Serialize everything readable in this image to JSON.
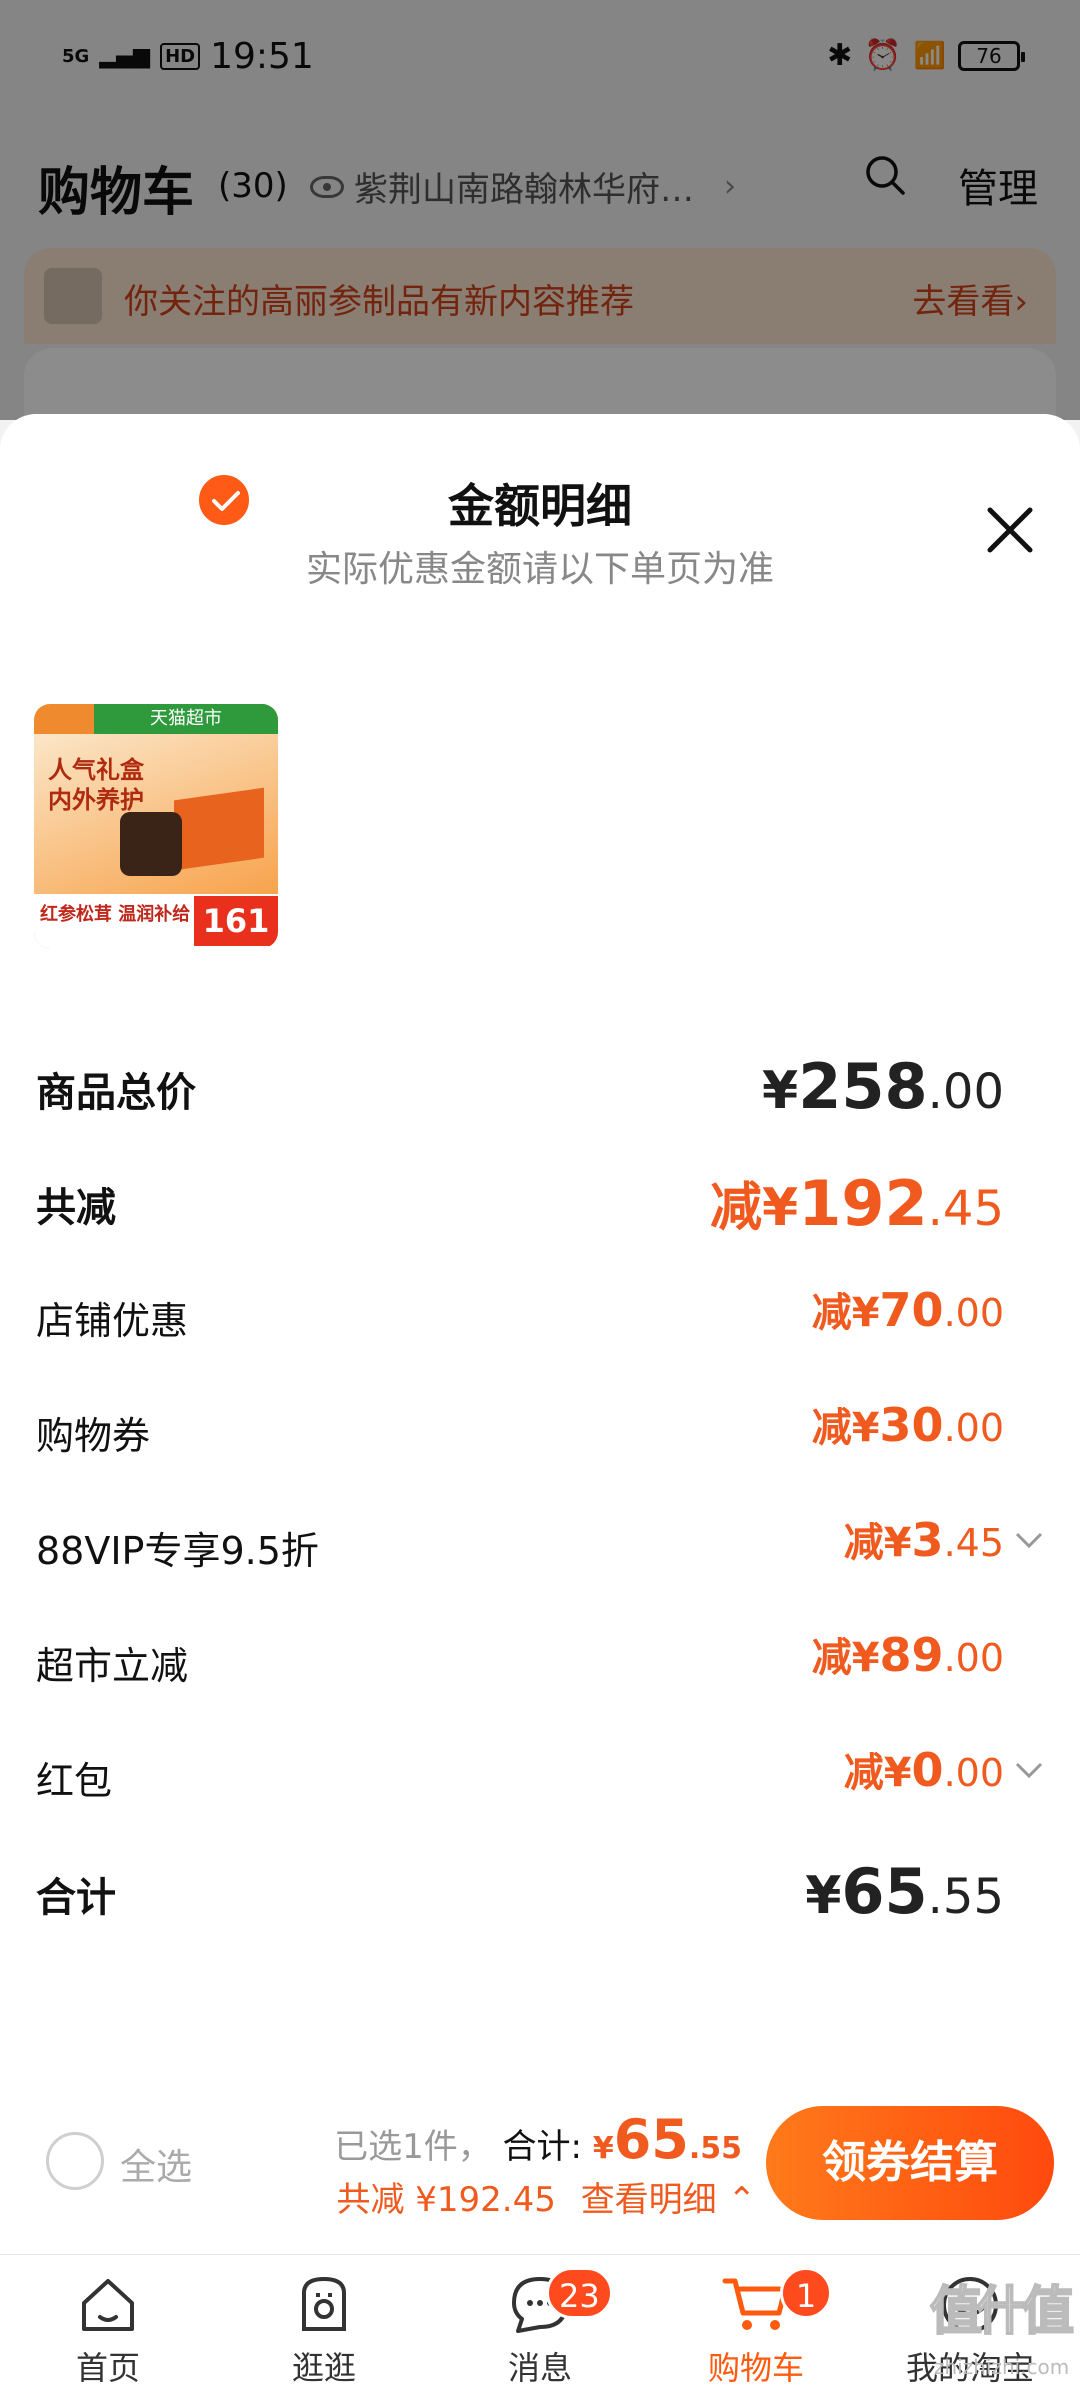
{
  "status_bar": {
    "network": "5G",
    "hd": "HD",
    "time": "19:51",
    "battery": "76"
  },
  "cart_header": {
    "title": "购物车",
    "count": "(30)",
    "location": "紫荆山南路翰林华府…",
    "manage_label": "管理"
  },
  "promo_banner": {
    "text": "你关注的高丽参制品有新内容推荐",
    "link": "去看看›"
  },
  "sheet": {
    "title": "金额明细",
    "subtitle": "实际优惠金额请以下单页为准"
  },
  "product": {
    "store_tag": "天猫超市",
    "line1": "人气礼盒",
    "line2": "内外养护",
    "strip_text": "红参松茸 温润补给",
    "price": "161"
  },
  "rows": [
    {
      "label": "商品总价",
      "prefix": "¥",
      "int": "258",
      "cents": ".00",
      "style": "black",
      "size": "big",
      "bold_label": true,
      "chevron": false
    },
    {
      "label": "共减",
      "prefix": "减¥",
      "int": "192",
      "cents": ".45",
      "style": "orange",
      "size": "big",
      "bold_label": true,
      "chevron": false
    },
    {
      "label": "店铺优惠",
      "prefix": "减¥",
      "int": "70",
      "cents": ".00",
      "style": "orange",
      "size": "med",
      "bold_label": false,
      "chevron": false
    },
    {
      "label": "购物券",
      "prefix": "减¥",
      "int": "30",
      "cents": ".00",
      "style": "orange",
      "size": "med",
      "bold_label": false,
      "chevron": false
    },
    {
      "label": "88VIP专享9.5折",
      "prefix": "减¥",
      "int": "3",
      "cents": ".45",
      "style": "orange",
      "size": "med",
      "bold_label": false,
      "chevron": true
    },
    {
      "label": "超市立减",
      "prefix": "减¥",
      "int": "89",
      "cents": ".00",
      "style": "orange",
      "size": "med",
      "bold_label": false,
      "chevron": false
    },
    {
      "label": "红包",
      "prefix": "减¥",
      "int": "0",
      "cents": ".00",
      "style": "orange",
      "size": "med",
      "bold_label": false,
      "chevron": true
    },
    {
      "label": "合计",
      "prefix": "¥",
      "int": "65",
      "cents": ".55",
      "style": "black",
      "size": "big",
      "bold_label": true,
      "chevron": false
    }
  ],
  "action_bar": {
    "select_all": "全选",
    "selected_text": "已选1件，",
    "total_label": "合计:",
    "total_currency": "¥",
    "total_int": "65",
    "total_cents": ".55",
    "discount_text": "共减 ¥192.45",
    "detail_link": "查看明细",
    "checkout": "领券结算"
  },
  "tabs": [
    {
      "label": "首页",
      "icon": "home-icon",
      "badge": ""
    },
    {
      "label": "逛逛",
      "icon": "explore-icon",
      "badge": ""
    },
    {
      "label": "消息",
      "icon": "message-icon",
      "badge": "23"
    },
    {
      "label": "购物车",
      "icon": "cart-icon",
      "badge": "1"
    },
    {
      "label": "我的淘宝",
      "icon": "profile-icon",
      "badge": ""
    }
  ],
  "watermark": {
    "big": "值什值",
    "small": "zhizhizhi.com"
  },
  "colors": {
    "accent": "#f05a1e",
    "button_gradient_start": "#ff7a1a",
    "button_gradient_end": "#ff4a0e"
  }
}
